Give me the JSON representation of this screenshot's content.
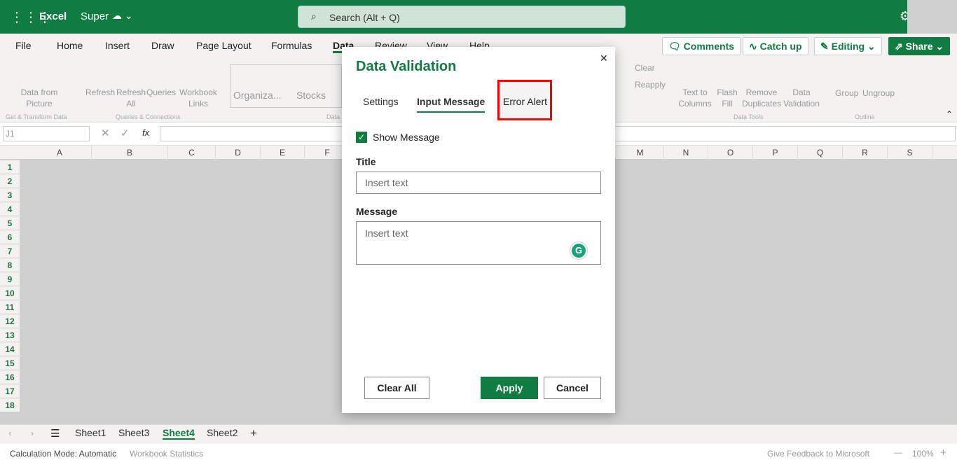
{
  "app": {
    "name": "Excel",
    "file": "Super",
    "search_placeholder": "Search (Alt + Q)"
  },
  "menu": [
    "File",
    "Home",
    "Insert",
    "Draw",
    "Page Layout",
    "Formulas",
    "Data",
    "Review",
    "View",
    "Help"
  ],
  "top_buttons": {
    "comments": "Comments",
    "catchup": "Catch up",
    "editing": "Editing",
    "share": "Share"
  },
  "ribbon": {
    "data_from_picture": "Data from Picture",
    "refresh": "Refresh",
    "refresh_all": "Refresh All",
    "queries": "Queries",
    "workbook_links": "Workbook Links",
    "organiza": "Organiza...",
    "stocks": "Stocks",
    "clear": "Clear",
    "reapply": "Reapply",
    "text_to_columns": "Text to Columns",
    "flash_fill": "Flash Fill",
    "remove_duplicates": "Remove Duplicates",
    "data_validation": "Data Validation",
    "group": "Group",
    "ungroup": "Ungroup",
    "groups": {
      "get_transform": "Get & Transform Data",
      "queries_conn": "Queries & Connections",
      "data_types": "Data",
      "data_tools": "Data Tools",
      "outline": "Outline"
    }
  },
  "formula_bar": {
    "name_box": "J1",
    "fx": "fx",
    "value": ""
  },
  "columns": [
    "A",
    "B",
    "C",
    "D",
    "E",
    "F",
    "M",
    "N",
    "O",
    "P",
    "Q",
    "R",
    "S"
  ],
  "rows": [
    "1",
    "2",
    "3",
    "4",
    "5",
    "6",
    "7",
    "8",
    "9",
    "10",
    "11",
    "12",
    "13",
    "14",
    "15",
    "16",
    "17",
    "18"
  ],
  "sheets": [
    "Sheet1",
    "Sheet3",
    "Sheet4",
    "Sheet2"
  ],
  "active_sheet": "Sheet4",
  "status": {
    "calc": "Calculation Mode: Automatic",
    "stats": "Workbook Statistics",
    "feedback": "Give Feedback to Microsoft",
    "zoom": "100%"
  },
  "dialog": {
    "title": "Data Validation",
    "tabs": [
      "Settings",
      "Input Message",
      "Error Alert"
    ],
    "active_tab": "Input Message",
    "highlighted_tab": "Error Alert",
    "show_message_label": "Show Message",
    "show_message_checked": true,
    "title_label": "Title",
    "title_placeholder": "Insert text",
    "message_label": "Message",
    "message_placeholder": "Insert text",
    "clear_all": "Clear All",
    "apply": "Apply",
    "cancel": "Cancel"
  },
  "colors": {
    "brand": "#107c41",
    "highlight": "#ff0000"
  }
}
